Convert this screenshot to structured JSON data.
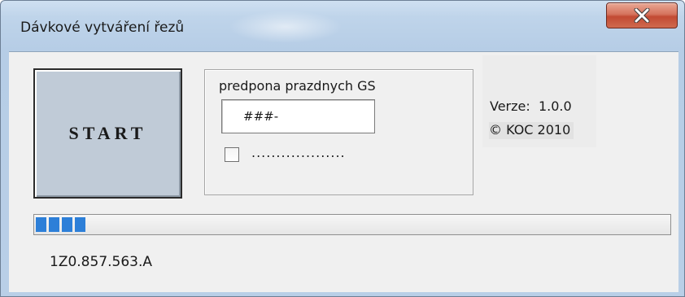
{
  "window": {
    "title": "Dávkové vytváření řezů"
  },
  "start_button": {
    "label": "START"
  },
  "prefix_group": {
    "label": "predpona prazdnych GS",
    "input_value": "###-",
    "checkbox_checked": false,
    "checkbox_label": "..................."
  },
  "info": {
    "version_label": "Verze:",
    "version_value": "1.0.0",
    "copyright": "© KOC 2010"
  },
  "progress": {
    "fraction": 0.08
  },
  "status": {
    "text": "1Z0.857.563.A"
  },
  "colors": {
    "progress_fill": "#2d7fd8",
    "close_button": "#c24a33"
  }
}
